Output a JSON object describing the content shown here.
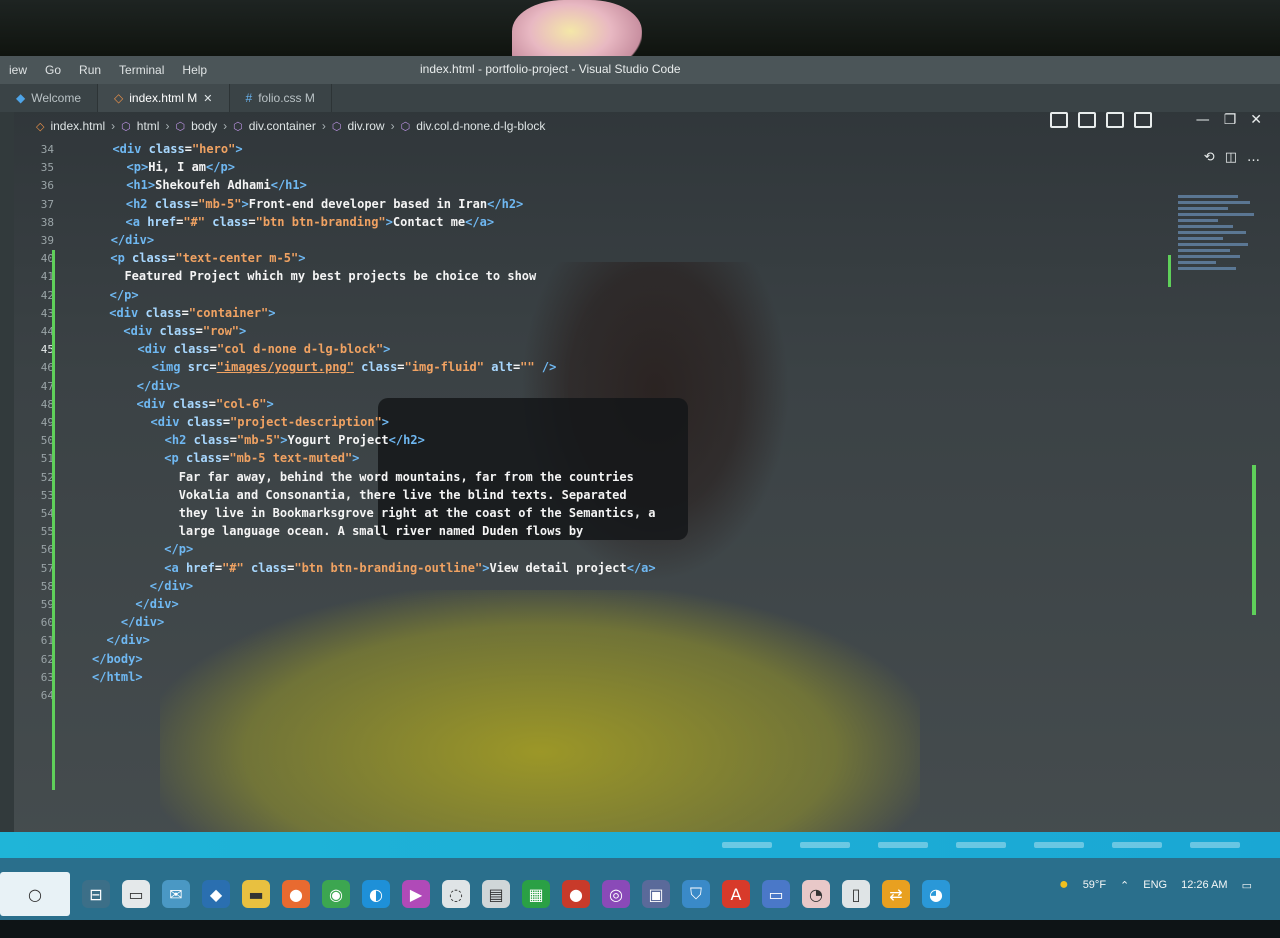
{
  "menu": [
    "iew",
    "Go",
    "Run",
    "Terminal",
    "Help"
  ],
  "window_title": "index.html - portfolio-project - Visual Studio Code",
  "tabs": [
    {
      "label": "Welcome",
      "icon": "vscode-icon"
    },
    {
      "label": "index.html M",
      "icon": "html-file-icon",
      "active": true
    },
    {
      "label": "folio.css M",
      "icon": "css-file-icon"
    }
  ],
  "breadcrumb": [
    "index.html",
    "html",
    "body",
    "div.container",
    "div.row",
    "div.col.d-none.d-lg-block"
  ],
  "lines": [
    {
      "n": "34",
      "code": "  <div class=\"hero\">"
    },
    {
      "n": "35",
      "code": "    <p>Hi, I am</p>"
    },
    {
      "n": "36",
      "code": "    <h1>Shekoufeh Adhami</h1>"
    },
    {
      "n": "37",
      "code": "    <h2 class=\"mb-5\">Front-end developer based in Iran</h2>"
    },
    {
      "n": "38",
      "code": "    <a href=\"#\" class=\"btn btn-branding\">Contact me</a>"
    },
    {
      "n": "39",
      "code": "  </div>"
    },
    {
      "n": "40",
      "code": "  <p class=\"text-center m-5\">"
    },
    {
      "n": "41",
      "code": "    Featured Project which my best projects be choice to show"
    },
    {
      "n": "42",
      "code": "  </p>"
    },
    {
      "n": "43",
      "code": "  <div class=\"container\">"
    },
    {
      "n": "44",
      "code": "    <div class=\"row\">"
    },
    {
      "n": "45",
      "code": "      <div class=\"col d-none d-lg-block\">"
    },
    {
      "n": "46",
      "code": "        <img src=\"images/yogurt.png\" class=\"img-fluid\" alt=\"\" />"
    },
    {
      "n": "47",
      "code": "      </div>"
    },
    {
      "n": "48",
      "code": "      <div class=\"col-6\">"
    },
    {
      "n": "49",
      "code": "        <div class=\"project-description\">"
    },
    {
      "n": "50",
      "code": "          <h2 class=\"mb-5\">Yogurt Project</h2>"
    },
    {
      "n": "51",
      "code": "          <p class=\"mb-5 text-muted\">"
    },
    {
      "n": "52",
      "code": "            Far far away, behind the word mountains, far from the countries"
    },
    {
      "n": "53",
      "code": "            Vokalia and Consonantia, there live the blind texts. Separated"
    },
    {
      "n": "54",
      "code": "            they live in Bookmarksgrove right at the coast of the Semantics, a"
    },
    {
      "n": "55",
      "code": "            large language ocean. A small river named Duden flows by"
    },
    {
      "n": "56",
      "code": "          </p>"
    },
    {
      "n": "57",
      "code": "          <a href=\"#\" class=\"btn btn-branding-outline\">View detail project</a>"
    },
    {
      "n": "58",
      "code": "        </div>"
    },
    {
      "n": "59",
      "code": "      </div>"
    },
    {
      "n": "60",
      "code": "    </div>"
    },
    {
      "n": "61",
      "code": "  </div>"
    },
    {
      "n": "62",
      "code": "</body>"
    },
    {
      "n": "63",
      "code": "</html>"
    },
    {
      "n": "64",
      "code": ""
    }
  ],
  "tray": {
    "temperature": "59°F",
    "language": "ENG",
    "time": "12:26 AM"
  }
}
